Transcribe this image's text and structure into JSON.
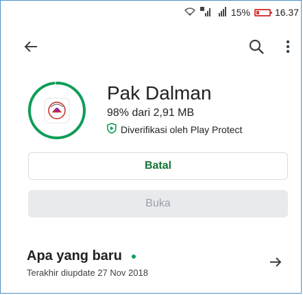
{
  "status_bar": {
    "battery_percent": "15%",
    "time": "16.37",
    "battery_color": "#d63b3b"
  },
  "toolbar": {
    "back_icon": "arrow-left-icon",
    "search_icon": "search-icon",
    "more_icon": "more-vert-icon"
  },
  "app": {
    "title": "Pak Dalman",
    "progress_text": "98% dari 2,91 MB",
    "progress": 0.98,
    "verified_text": "Diverifikasi oleh Play Protect",
    "accent_color": "#0f9d58"
  },
  "buttons": {
    "cancel_label": "Batal",
    "open_label": "Buka"
  },
  "whats_new": {
    "title": "Apa yang baru",
    "updated": "Terakhir diupdate 27 Nov 2018"
  }
}
